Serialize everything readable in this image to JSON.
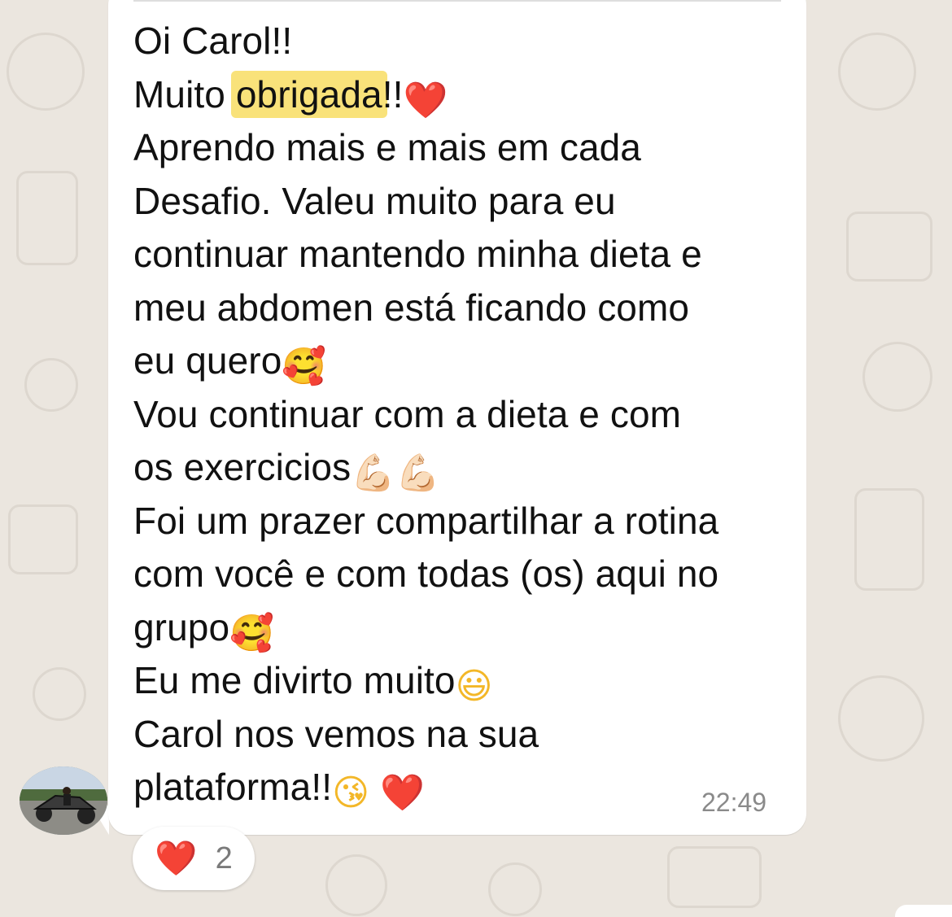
{
  "message": {
    "lines": {
      "l1": "Oi Carol!!",
      "l2_pre": "Muito ",
      "l2_highlight": "obrigada",
      "l2_post": "!!",
      "l3": "Aprendo mais e mais em cada",
      "l4": "Desafio. Valeu muito para eu",
      "l5": "continuar mantendo minha dieta e",
      "l6": "meu abdomen está ficando como",
      "l7": "eu quero",
      "l8": "Vou continuar com a dieta e com",
      "l9": "os exercicios",
      "l10": "Foi um prazer compartilhar a rotina",
      "l11": "com você e com todas (os) aqui no",
      "l12": "grupo",
      "l13": "Eu me divirto muito",
      "l14": "Carol nos vemos na sua",
      "l15": "plataforma!!"
    },
    "emojis": {
      "red_heart": "❤️",
      "smiling_hearts": "🥰",
      "flexed_biceps": "💪🏻",
      "grinning": "😃",
      "kissing_heart": "😘"
    },
    "time": "22:49",
    "highlight_color": "#f9e27a"
  },
  "reaction": {
    "emoji": "❤️",
    "count": "2"
  },
  "avatar": {
    "icon": "avatar-photo"
  }
}
